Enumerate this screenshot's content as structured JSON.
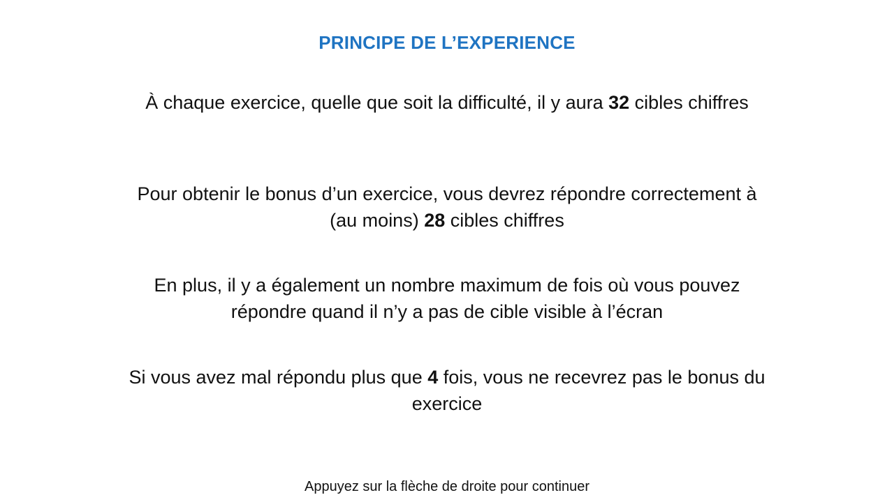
{
  "title": "PRINCIPE DE L’EXPERIENCE",
  "paragraphs": [
    {
      "before": "À chaque exercice, quelle que soit la difficulté, il y aura ",
      "bold": "32",
      "after": " cibles chiffres"
    },
    {
      "before": "Pour obtenir le bonus d’un exercice, vous devrez répondre correctement à (au moins) ",
      "bold": "28",
      "after": " cibles chiffres"
    },
    {
      "text": "En plus, il y a également un nombre maximum de fois où vous pouvez répondre quand il n’y a pas de cible visible à l’écran"
    },
    {
      "before": "Si vous avez mal répondu plus que ",
      "bold": "4",
      "after": " fois, vous ne recevrez pas le bonus du exercice"
    }
  ],
  "footer": "Appuyez sur la flèche de droite pour continuer",
  "colors": {
    "title": "#1f74c2",
    "text": "#111111",
    "background": "#ffffff"
  }
}
